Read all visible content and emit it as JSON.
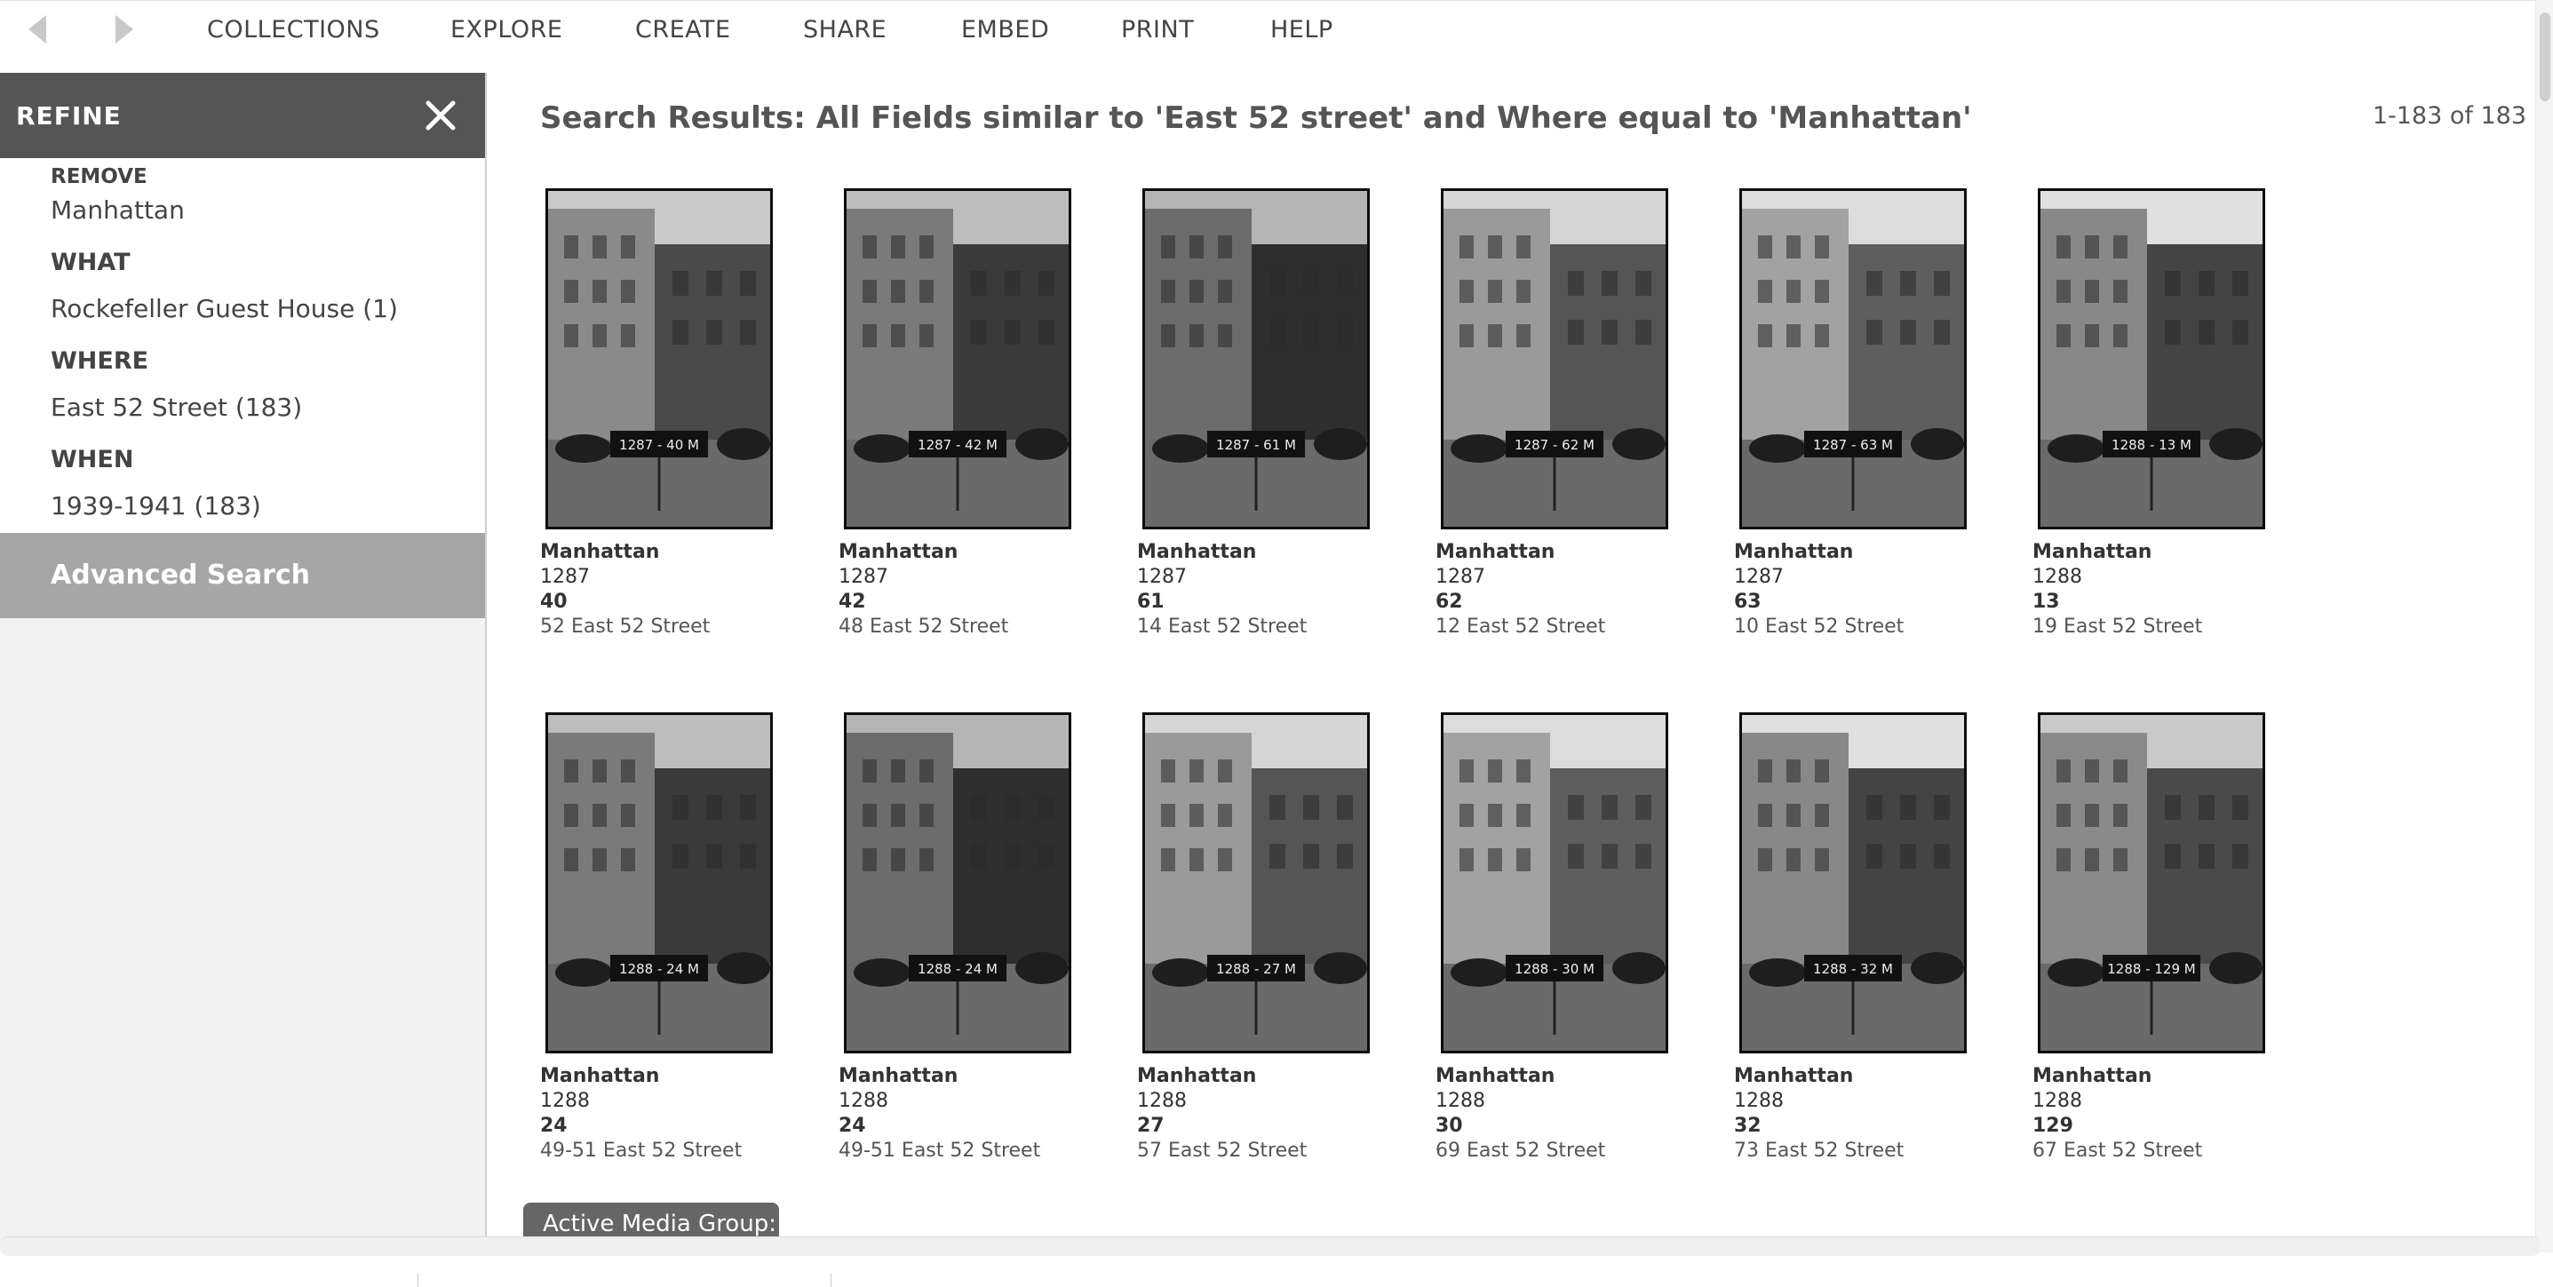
{
  "nav": {
    "items": [
      "COLLECTIONS",
      "EXPLORE",
      "CREATE",
      "SHARE",
      "EMBED",
      "PRINT",
      "HELP"
    ]
  },
  "sidebar": {
    "title": "REFINE",
    "remove_label": "REMOVE",
    "remove_value": "Manhattan",
    "what_label": "WHAT",
    "what_value": "Rockefeller Guest House (1)",
    "where_label": "WHERE",
    "where_value": "East 52 Street (183)",
    "when_label": "WHEN",
    "when_value": "1939-1941 (183)",
    "advanced_search": "Advanced Search"
  },
  "results": {
    "title": "Search Results: All Fields similar to 'East 52 street' and Where equal to 'Manhattan'",
    "count": "1-183 of 183",
    "items": [
      {
        "borough": "Manhattan",
        "block": "1287",
        "lot": "40",
        "address": "52 East 52 Street"
      },
      {
        "borough": "Manhattan",
        "block": "1287",
        "lot": "42",
        "address": "48 East 52 Street"
      },
      {
        "borough": "Manhattan",
        "block": "1287",
        "lot": "61",
        "address": "14 East 52 Street"
      },
      {
        "borough": "Manhattan",
        "block": "1287",
        "lot": "62",
        "address": "12 East 52 Street"
      },
      {
        "borough": "Manhattan",
        "block": "1287",
        "lot": "63",
        "address": "10 East 52 Street"
      },
      {
        "borough": "Manhattan",
        "block": "1288",
        "lot": "13",
        "address": "19 East 52 Street"
      },
      {
        "borough": "Manhattan",
        "block": "1288",
        "lot": "24",
        "address": "49-51 East 52 Street"
      },
      {
        "borough": "Manhattan",
        "block": "1288",
        "lot": "24",
        "address": "49-51 East 52 Street"
      },
      {
        "borough": "Manhattan",
        "block": "1288",
        "lot": "27",
        "address": "57 East 52 Street"
      },
      {
        "borough": "Manhattan",
        "block": "1288",
        "lot": "30",
        "address": "69 East 52 Street"
      },
      {
        "borough": "Manhattan",
        "block": "1288",
        "lot": "32",
        "address": "73 East 52 Street"
      },
      {
        "borough": "Manhattan",
        "block": "1288",
        "lot": "129",
        "address": "67 East 52 Street"
      }
    ]
  },
  "signs": [
    "1287 - 40  M",
    "1287 - 42  M",
    "1287 - 61  M",
    "1287 - 62  M",
    "1287 - 63  M",
    "1288 - 13  M",
    "1288 - 24  M",
    "1288 - 24  M",
    "1288 - 27  M",
    "1288 - 30  M",
    "1288 - 32  M",
    "1288 - 129  M"
  ],
  "media_group": {
    "label": "Active Media Group:"
  },
  "icons": {
    "back": "back-arrow-icon",
    "forward": "forward-arrow-icon",
    "close": "close-icon"
  }
}
